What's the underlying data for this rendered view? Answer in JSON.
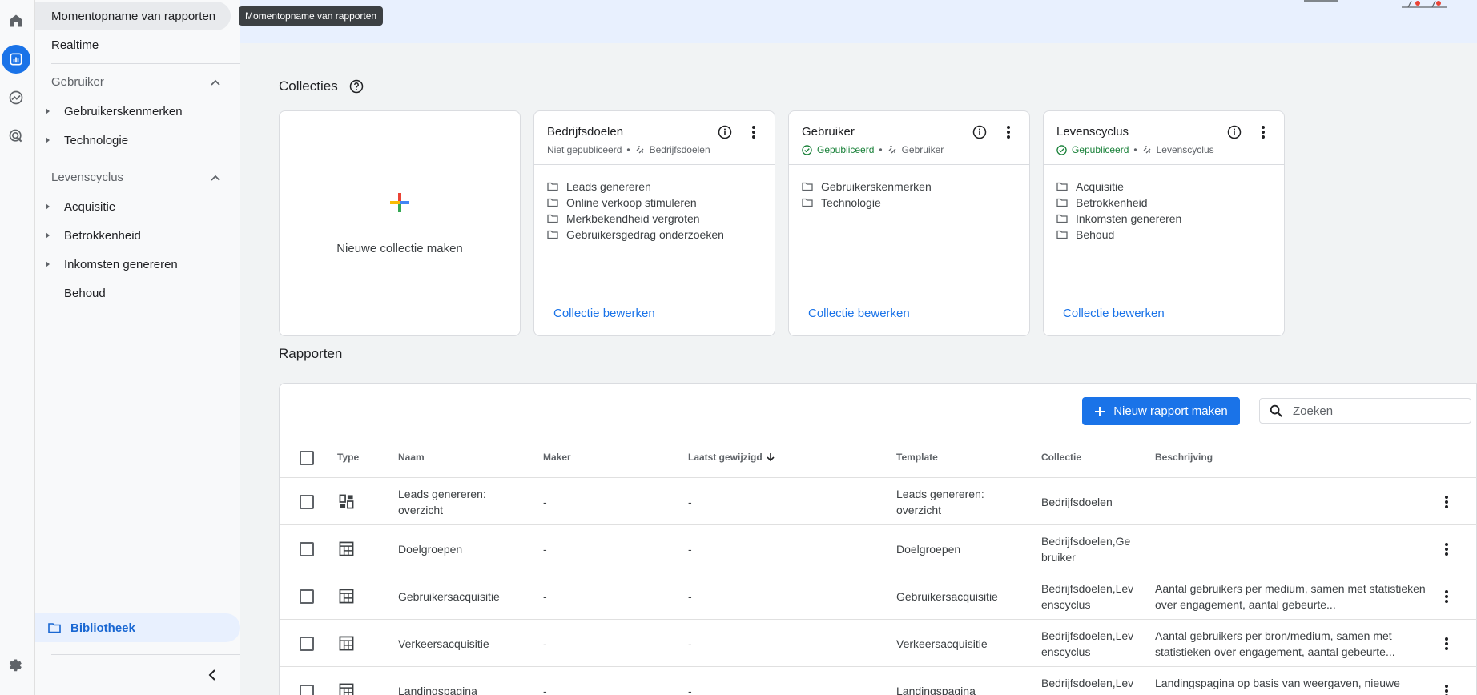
{
  "tooltip": "Momentopname van rapporten",
  "nav": {
    "snapshot": "Momentopname van rapporten",
    "realtime": "Realtime",
    "section_user": "Gebruiker",
    "user_items": [
      "Gebruikerskenmerken",
      "Technologie"
    ],
    "section_lifecycle": "Levenscyclus",
    "lifecycle_items": [
      "Acquisitie",
      "Betrokkenheid",
      "Inkomsten genereren",
      "Behoud"
    ],
    "library": "Bibliotheek"
  },
  "collections": {
    "title": "Collecties",
    "new_label": "Nieuwe collectie maken",
    "cards": [
      {
        "title": "Bedrijfsdoelen",
        "status": "Niet gepubliceerd",
        "template": "Bedrijfsdoelen",
        "items": [
          "Leads genereren",
          "Online verkoop stimuleren",
          "Merkbekendheid vergroten",
          "Gebruikersgedrag onderzoeken"
        ],
        "link": "Collectie bewerken"
      },
      {
        "title": "Gebruiker",
        "status": "Gepubliceerd",
        "template": "Gebruiker",
        "items": [
          "Gebruikerskenmerken",
          "Technologie"
        ],
        "link": "Collectie bewerken"
      },
      {
        "title": "Levenscyclus",
        "status": "Gepubliceerd",
        "template": "Levenscyclus",
        "items": [
          "Acquisitie",
          "Betrokkenheid",
          "Inkomsten genereren",
          "Behoud"
        ],
        "link": "Collectie bewerken"
      }
    ]
  },
  "reports": {
    "title": "Rapporten",
    "new_button": "Nieuw rapport maken",
    "search_placeholder": "Zoeken",
    "columns": {
      "type": "Type",
      "name": "Naam",
      "maker": "Maker",
      "modified": "Laatst gewijzigd",
      "template": "Template",
      "collection": "Collectie",
      "description": "Beschrijving"
    },
    "rows": [
      {
        "type": "overview",
        "name": "Leads genereren: overzicht",
        "maker": "-",
        "modified": "-",
        "template": "Leads genereren: overzicht",
        "collection": "Bedrijfsdoelen",
        "description": ""
      },
      {
        "type": "detail",
        "name": "Doelgroepen",
        "maker": "-",
        "modified": "-",
        "template": "Doelgroepen",
        "collection": "Bedrijfsdoelen,Gebruiker",
        "description": ""
      },
      {
        "type": "detail",
        "name": "Gebruikersacquisitie",
        "maker": "-",
        "modified": "-",
        "template": "Gebruikersacquisitie",
        "collection": "Bedrijfsdoelen,Levenscyclus",
        "description": "Aantal gebruikers per medium, samen met statistieken over engagement, aantal gebeurte..."
      },
      {
        "type": "detail",
        "name": "Verkeersacquisitie",
        "maker": "-",
        "modified": "-",
        "template": "Verkeersacquisitie",
        "collection": "Bedrijfsdoelen,Levenscyclus",
        "description": "Aantal gebruikers per bron/medium, samen met statistieken over engagement, aantal gebeurte..."
      },
      {
        "type": "detail",
        "name": "Landingspagina",
        "maker": "-",
        "modified": "-",
        "template": "Landingspagina",
        "collection": "Bedrijfsdoelen,Levenscyclus",
        "description": "Landingspagina op basis van weergaven, nieuwe"
      }
    ]
  },
  "colors": {
    "accent": "#1a73e8",
    "published": "#188038"
  }
}
